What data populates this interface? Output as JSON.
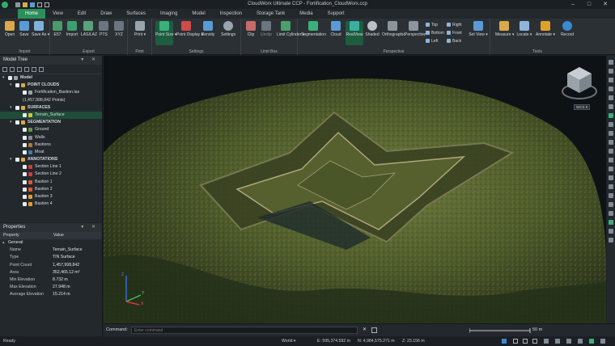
{
  "window": {
    "title": "CloudWorx Ultimate CCP - Fortification_CloudWorx.ccp"
  },
  "tabs": [
    "Home",
    "View",
    "Edit",
    "Draw",
    "Surfaces",
    "Imaging",
    "Model",
    "Inspection",
    "Storage Tank",
    "Media",
    "Support"
  ],
  "ribbon": {
    "groups": {
      "import": "Import",
      "export": "Export",
      "print": "Print",
      "settings": "Settings",
      "limitbox": "Limit Box",
      "perspective": "Perspective",
      "tools": "Tools"
    },
    "buttons": {
      "open": "Open",
      "save": "Save",
      "save_as": "Save As ▾",
      "e57": "E57",
      "import": "Import",
      "laslaz": "LAS/LAZ",
      "pts": "PTS",
      "xyz": "XYZ",
      "print": "Print ▾",
      "point_size": "Point Size ▾",
      "point_display": "Point Display ▾",
      "density": "Density",
      "settings": "Settings",
      "clip": "Clip",
      "unclip": "Unclip",
      "limit_cylinder": "Limit Cylinder ▾",
      "segmentation": "Segmentation",
      "cloud": "Cloud",
      "realview": "RealView",
      "shaded": "Shaded",
      "orthographic": "Orthographic",
      "perspective": "Perspective",
      "top": "Top",
      "bottom": "Bottom",
      "left": "Left",
      "right": "Right",
      "front": "Front",
      "back": "Back",
      "set_view": "Set View ▾",
      "measure": "Measure ▾",
      "locate": "Locate ▾",
      "annotate": "Annotate ▾",
      "record": "Record"
    }
  },
  "model_tree": {
    "title": "Model Tree",
    "items": [
      {
        "label": "Model",
        "level": 0,
        "type": "root"
      },
      {
        "label": "POINT CLOUDS",
        "level": 1,
        "type": "group"
      },
      {
        "label": "Fortification_Bastion.las",
        "level": 2,
        "type": "item"
      },
      {
        "label": "(1,457,998,842 Points)",
        "level": 2,
        "type": "note"
      },
      {
        "label": "SURFACES",
        "level": 1,
        "type": "group"
      },
      {
        "label": "Terrain_Surface",
        "level": 2,
        "type": "item",
        "selected": true,
        "color": "#d8c23a"
      },
      {
        "label": "SEGMENTATION",
        "level": 1,
        "type": "group"
      },
      {
        "label": "Ground",
        "level": 2,
        "type": "item",
        "color": "#5a9a3a"
      },
      {
        "label": "Walls",
        "level": 2,
        "type": "item",
        "color": "#8c8c8c"
      },
      {
        "label": "Bastions",
        "level": 2,
        "type": "item",
        "color": "#b07a3a"
      },
      {
        "label": "Moat",
        "level": 2,
        "type": "item",
        "color": "#3a7ab0"
      },
      {
        "label": "ANNOTATIONS",
        "level": 1,
        "type": "group"
      },
      {
        "label": "Section Line 1",
        "level": 2,
        "type": "item",
        "color": "#d23a3a"
      },
      {
        "label": "Section Line 2",
        "level": 2,
        "type": "item",
        "color": "#d23a3a"
      },
      {
        "label": "Bastion 1",
        "level": 2,
        "type": "item",
        "color": "#e05a2a"
      },
      {
        "label": "Bastion 2",
        "level": 2,
        "type": "item",
        "color": "#e05a2a"
      },
      {
        "label": "Bastion 3",
        "level": 2,
        "type": "item",
        "color": "#e0a02a"
      },
      {
        "label": "Bastion 4",
        "level": 2,
        "type": "item",
        "color": "#e0a02a"
      }
    ]
  },
  "properties": {
    "title": "Properties",
    "col_property": "Property",
    "col_value": "Value",
    "section": "General",
    "rows": [
      {
        "k": "Name",
        "v": "Terrain_Surface"
      },
      {
        "k": "Type",
        "v": "TIN Surface"
      },
      {
        "k": "Point Count",
        "v": "1,457,998,842"
      },
      {
        "k": "Area",
        "v": "352,465.12 m²"
      },
      {
        "k": "Min Elevation",
        "v": "8.732 m"
      },
      {
        "k": "Max Elevation",
        "v": "27.948 m"
      },
      {
        "k": "Average Elevation",
        "v": "15.214 m"
      }
    ]
  },
  "viewport": {
    "wcs_label": "WCS ▾",
    "axis_labels": {
      "x": "X",
      "y": "Y",
      "z": "Z"
    }
  },
  "command": {
    "label": "Command:",
    "placeholder": "Enter command",
    "scale_label": "50 m"
  },
  "status": {
    "ready": "Ready",
    "coord_system": "World ▾",
    "e": "E: 595,374.592 m",
    "n": "N: 4,984,575.271 m",
    "z": "Z: 23.156 m"
  },
  "colors": {
    "accent": "#2a8f5a",
    "selection": "#1f4d39"
  }
}
